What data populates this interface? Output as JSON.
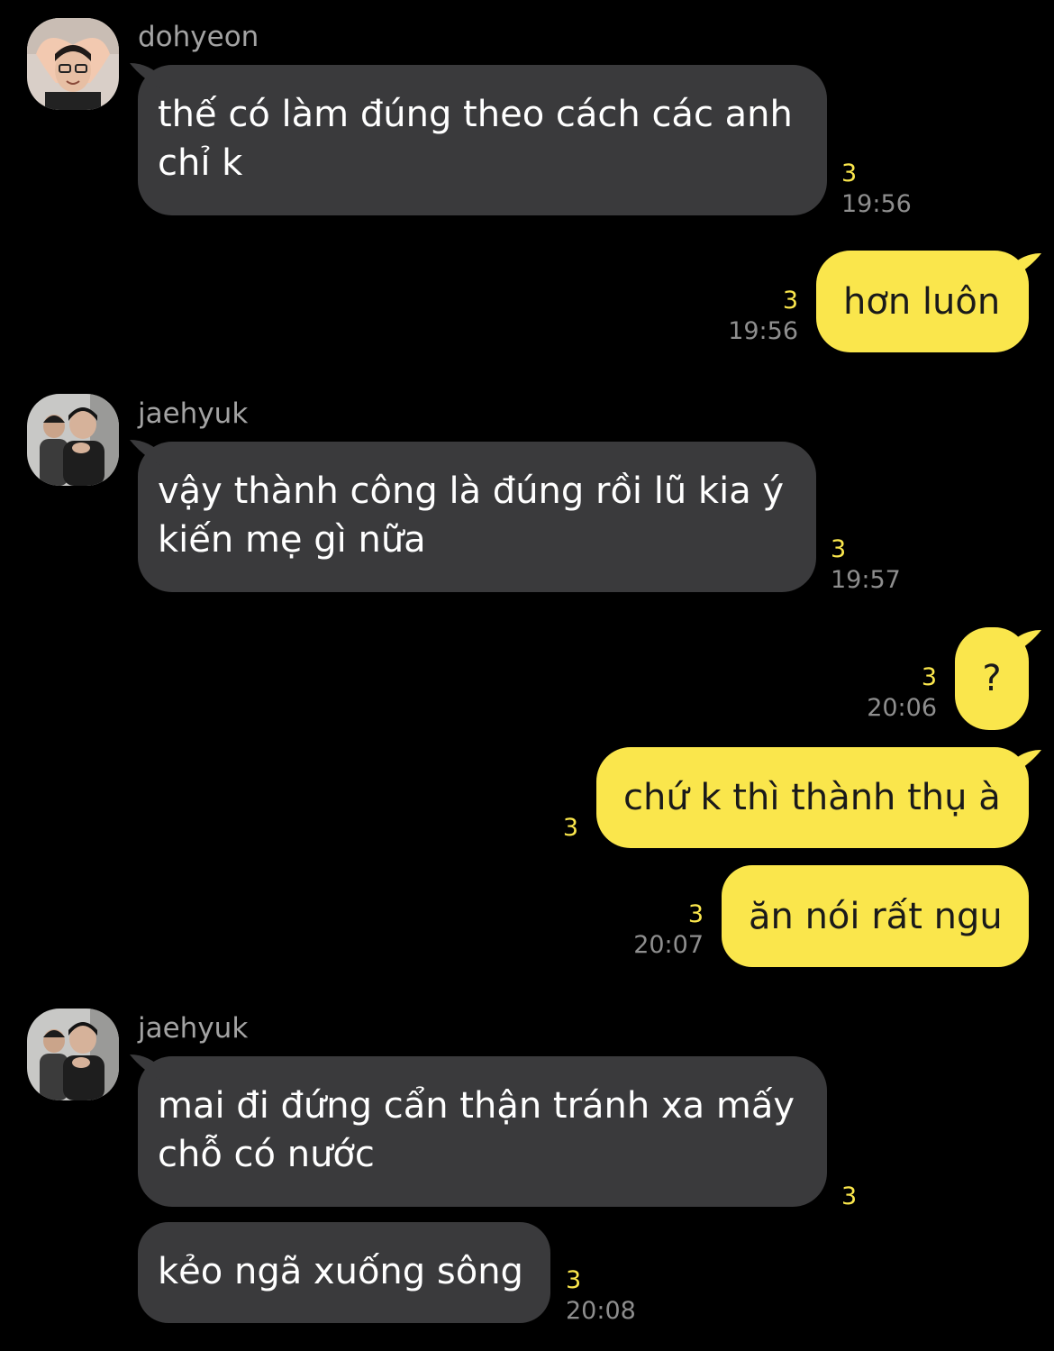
{
  "colors": {
    "background": "#000000",
    "incoming_bubble": "#3a3a3c",
    "outgoing_bubble": "#fae64c",
    "unread_count": "#fae64c",
    "timestamp": "#8e8e8e",
    "sender_name": "#a3a3a3"
  },
  "messages": [
    {
      "sender": "dohyeon",
      "line1": "thế có làm đúng theo cách các anh",
      "line2": "chỉ k",
      "unread": "3",
      "time": "19:56"
    },
    {
      "text": "hơn luôn",
      "unread": "3",
      "time": "19:56"
    },
    {
      "sender": "jaehyuk",
      "line1": "vậy thành công là đúng rồi lũ kia ý",
      "line2": "kiến mẹ gì nữa",
      "unread": "3",
      "time": "19:57"
    },
    {
      "text": "?",
      "unread": "3",
      "time": "20:06"
    },
    {
      "text": "chứ k thì thành thụ à",
      "unread": "3"
    },
    {
      "text": "ăn nói rất ngu",
      "unread": "3",
      "time": "20:07"
    },
    {
      "sender": "jaehyuk",
      "line1": "mai đi đứng cẩn thận tránh xa mấy",
      "line2": "chỗ có nước",
      "unread": "3"
    },
    {
      "line1": "kẻo ngã xuống sông",
      "unread": "3",
      "time": "20:08"
    }
  ]
}
